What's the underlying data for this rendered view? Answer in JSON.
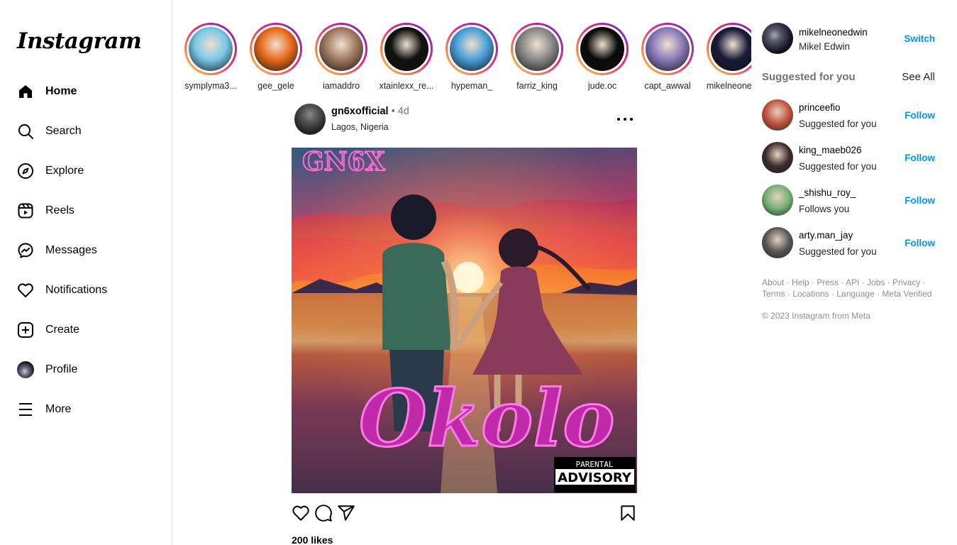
{
  "app": {
    "logo": "Instagram"
  },
  "sidebar": {
    "items": [
      {
        "label": "Home",
        "icon": "home-icon"
      },
      {
        "label": "Search",
        "icon": "search-icon"
      },
      {
        "label": "Explore",
        "icon": "compass-icon"
      },
      {
        "label": "Reels",
        "icon": "reels-icon"
      },
      {
        "label": "Messages",
        "icon": "messenger-icon"
      },
      {
        "label": "Notifications",
        "icon": "heart-icon"
      },
      {
        "label": "Create",
        "icon": "plus-square-icon"
      },
      {
        "label": "Profile",
        "icon": "profile-avatar"
      },
      {
        "label": "More",
        "icon": "menu-icon"
      }
    ]
  },
  "stories": [
    {
      "name": "symplyma3...",
      "color": "#7bc8e8"
    },
    {
      "name": "gee_gele",
      "color": "#e86a1a"
    },
    {
      "name": "iamaddro",
      "color": "#a07860"
    },
    {
      "name": "xtainlexx_re...",
      "color": "#111111"
    },
    {
      "name": "hypeman_",
      "color": "#4a9fd8"
    },
    {
      "name": "farriz_king",
      "color": "#888888"
    },
    {
      "name": "jude.oc",
      "color": "#0a0a0a"
    },
    {
      "name": "capt_awwal",
      "color": "#8a7ab8"
    },
    {
      "name": "mikelneone...",
      "color": "#1a1a3a"
    }
  ],
  "post": {
    "username": "gn6xofficial",
    "separator": "•",
    "time": "4d",
    "location": "Lagos, Nigeria",
    "artwork_title": "Okolo",
    "artwork_brand": "GN6X",
    "artwork_advisory_top": "PARENTAL",
    "artwork_advisory_main": "ADVISORY",
    "likes": "200 likes"
  },
  "right": {
    "me": {
      "username": "mikelneonedwin",
      "name": "Mikel Edwin",
      "switch_label": "Switch"
    },
    "suggested_title": "Suggested for you",
    "see_all": "See All",
    "suggestions": [
      {
        "username": "princeefio",
        "subtitle": "Suggested for you",
        "action": "Follow",
        "color": "#c0503a"
      },
      {
        "username": "king_maeb026",
        "subtitle": "Suggested for you",
        "action": "Follow",
        "color": "#3a2a2a"
      },
      {
        "username": "_shishu_roy_",
        "subtitle": "Follows you",
        "action": "Follow",
        "color": "#6fb070"
      },
      {
        "username": "arty.man_jay",
        "subtitle": "Suggested for you",
        "action": "Follow",
        "color": "#555555"
      }
    ],
    "footer_links_row1": "About · Help · Press · API · Jobs · Privacy ·",
    "footer_links_row2": "Terms · Locations · Language · Meta Verified",
    "copyright": "© 2023 Instagram from Meta"
  },
  "colors": {
    "accent": "#0095f6",
    "border": "#dbdbdb",
    "muted": "#737373"
  }
}
